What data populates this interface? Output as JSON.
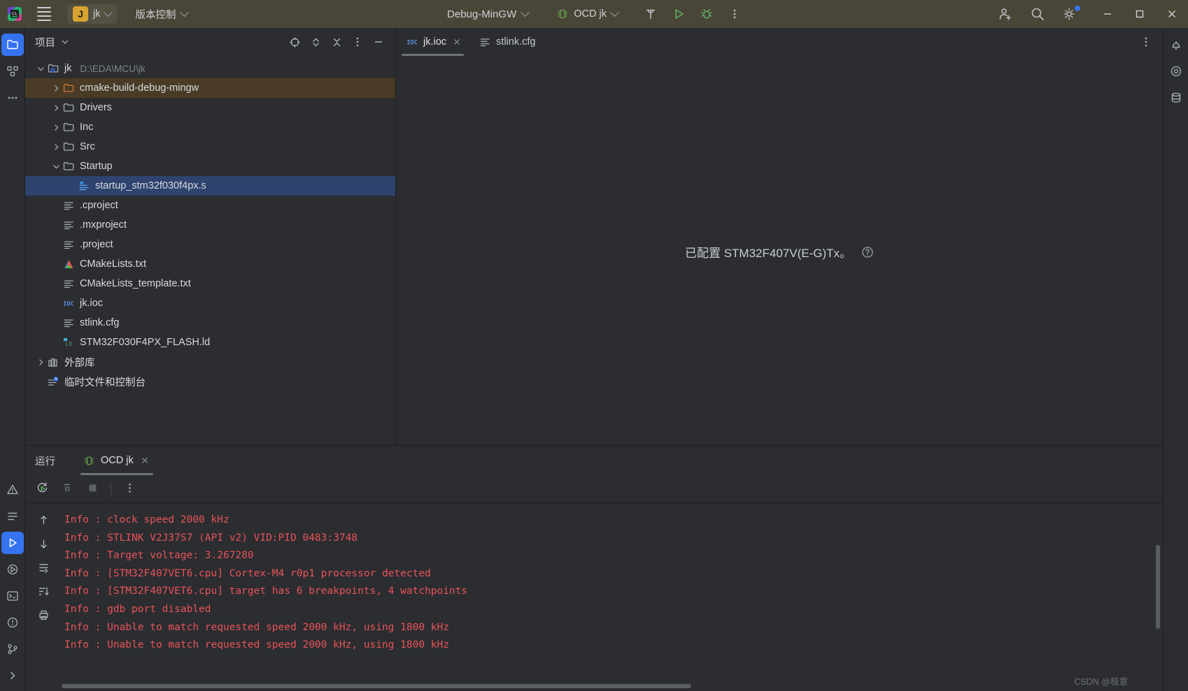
{
  "titlebar": {
    "logo_icon": "clion-logo-icon",
    "menu_icon": "hamburger-menu-icon",
    "project_initial": "J",
    "project_name": "jk",
    "vcs_label": "版本控制",
    "run_config": "Debug-MinGW",
    "debug_config": "OCD jk",
    "build_icon": "hammer-icon",
    "run_icon": "run-play-icon",
    "debug_icon": "debug-bug-icon",
    "more_icon": "more-vertical-icon",
    "account_icon": "add-user-icon",
    "search_icon": "search-icon",
    "settings_icon": "gear-icon",
    "minimize_icon": "minimize-icon",
    "maximize_icon": "maximize-icon",
    "close_icon": "close-icon"
  },
  "leftbar": {
    "items": [
      {
        "name": "project-tool-icon",
        "selected": true
      },
      {
        "name": "structure-tool-icon",
        "selected": false
      },
      {
        "name": "more-tools-icon",
        "selected": false
      }
    ],
    "bottom_items": [
      {
        "name": "problems-warning-icon"
      },
      {
        "name": "todo-list-icon"
      },
      {
        "name": "run-tool-icon",
        "selected": true
      },
      {
        "name": "services-icon"
      },
      {
        "name": "terminal-icon"
      },
      {
        "name": "problems-icon"
      },
      {
        "name": "version-control-icon"
      },
      {
        "name": "expand-right-icon"
      }
    ]
  },
  "rightbar": {
    "items": [
      {
        "name": "notifications-bell-icon"
      },
      {
        "name": "ai-assistant-icon"
      },
      {
        "name": "database-icon"
      }
    ]
  },
  "project_panel": {
    "title": "项目",
    "dropdown_icon": "chevron-down-icon",
    "actions": [
      {
        "name": "locate-target-icon"
      },
      {
        "name": "expand-collapse-icon"
      },
      {
        "name": "collapse-all-icon"
      },
      {
        "name": "panel-options-icon"
      },
      {
        "name": "hide-panel-icon"
      }
    ],
    "tree": [
      {
        "label": "jk",
        "path": "D:\\EDA\\MCU\\jk",
        "indent": 0,
        "arrow": "down",
        "icon": "project-folder-icon",
        "state": "normal"
      },
      {
        "label": "cmake-build-debug-mingw",
        "path": "",
        "indent": 1,
        "arrow": "right",
        "icon": "folder-orange-icon",
        "state": "highlight"
      },
      {
        "label": "Drivers",
        "path": "",
        "indent": 1,
        "arrow": "right",
        "icon": "folder-icon",
        "state": "normal"
      },
      {
        "label": "Inc",
        "path": "",
        "indent": 1,
        "arrow": "right",
        "icon": "folder-icon",
        "state": "normal"
      },
      {
        "label": "Src",
        "path": "",
        "indent": 1,
        "arrow": "right",
        "icon": "folder-icon",
        "state": "normal"
      },
      {
        "label": "Startup",
        "path": "",
        "indent": 1,
        "arrow": "down",
        "icon": "folder-icon",
        "state": "normal"
      },
      {
        "label": "startup_stm32f030f4px.s",
        "path": "",
        "indent": 2,
        "arrow": "none",
        "icon": "asm-file-icon",
        "state": "selected"
      },
      {
        "label": ".cproject",
        "path": "",
        "indent": 1,
        "arrow": "none",
        "icon": "text-file-icon",
        "state": "normal"
      },
      {
        "label": ".mxproject",
        "path": "",
        "indent": 1,
        "arrow": "none",
        "icon": "text-file-icon",
        "state": "normal"
      },
      {
        "label": ".project",
        "path": "",
        "indent": 1,
        "arrow": "none",
        "icon": "text-file-icon",
        "state": "normal"
      },
      {
        "label": "CMakeLists.txt",
        "path": "",
        "indent": 1,
        "arrow": "none",
        "icon": "cmake-file-icon",
        "state": "normal"
      },
      {
        "label": "CMakeLists_template.txt",
        "path": "",
        "indent": 1,
        "arrow": "none",
        "icon": "text-file-icon",
        "state": "normal"
      },
      {
        "label": "jk.ioc",
        "path": "",
        "indent": 1,
        "arrow": "none",
        "icon": "ioc-file-icon",
        "state": "normal"
      },
      {
        "label": "stlink.cfg",
        "path": "",
        "indent": 1,
        "arrow": "none",
        "icon": "text-file-icon",
        "state": "normal"
      },
      {
        "label": "STM32F030F4PX_FLASH.ld",
        "path": "",
        "indent": 1,
        "arrow": "none",
        "icon": "ld-file-icon",
        "state": "normal"
      },
      {
        "label": "外部库",
        "path": "",
        "indent": 0,
        "arrow": "right",
        "icon": "external-libraries-icon",
        "state": "normal"
      },
      {
        "label": "临时文件和控制台",
        "path": "",
        "indent": 0,
        "arrow": "none",
        "icon": "scratches-icon",
        "state": "normal"
      }
    ]
  },
  "editor": {
    "tabs": [
      {
        "label": "jk.ioc",
        "icon": "ioc-file-icon",
        "active": true,
        "closable": true
      },
      {
        "label": "stlink.cfg",
        "icon": "text-file-icon",
        "active": false,
        "closable": false
      }
    ],
    "options_icon": "editor-options-icon",
    "message": "已配置 STM32F407V(E-G)Tx。",
    "help_icon": "help-circle-icon"
  },
  "run_panel": {
    "label": "运行",
    "tab_label": "OCD jk",
    "tab_icon": "chip-icon",
    "tab_close_icon": "close-icon",
    "gutter_icons": [
      "scroll-up-icon",
      "scroll-down-icon",
      "soft-wrap-icon",
      "sort-icon",
      "print-icon"
    ],
    "toolbar_icons": [
      "rerun-icon",
      "restart-icon",
      "stop-icon",
      "more-vertical-icon"
    ],
    "console_lines": [
      "Info : clock speed 2000 kHz",
      "Info : STLINK V2J37S7 (API v2) VID:PID 0483:3748",
      "Info : Target voltage: 3.267280",
      "Info : [STM32F407VET6.cpu] Cortex-M4 r0p1 processor detected",
      "Info : [STM32F407VET6.cpu] target has 6 breakpoints, 4 watchpoints",
      "Info : gdb port disabled",
      "Info : Unable to match requested speed 2000 kHz, using 1800 kHz",
      "Info : Unable to match requested speed 2000 kHz, using 1800 kHz"
    ],
    "console_text_color": "#e8535a"
  },
  "watermark": "CSDN @极意",
  "colors": {
    "titlebar_bg": "#4a4637",
    "panel_bg": "#2b2d30",
    "selection_blue": "#2e436e",
    "highlight_brown": "#4a3b26",
    "accent_blue": "#3573f0",
    "green": "#5fad65",
    "orange_folder": "#cc7832",
    "console_red": "#e8535a"
  }
}
